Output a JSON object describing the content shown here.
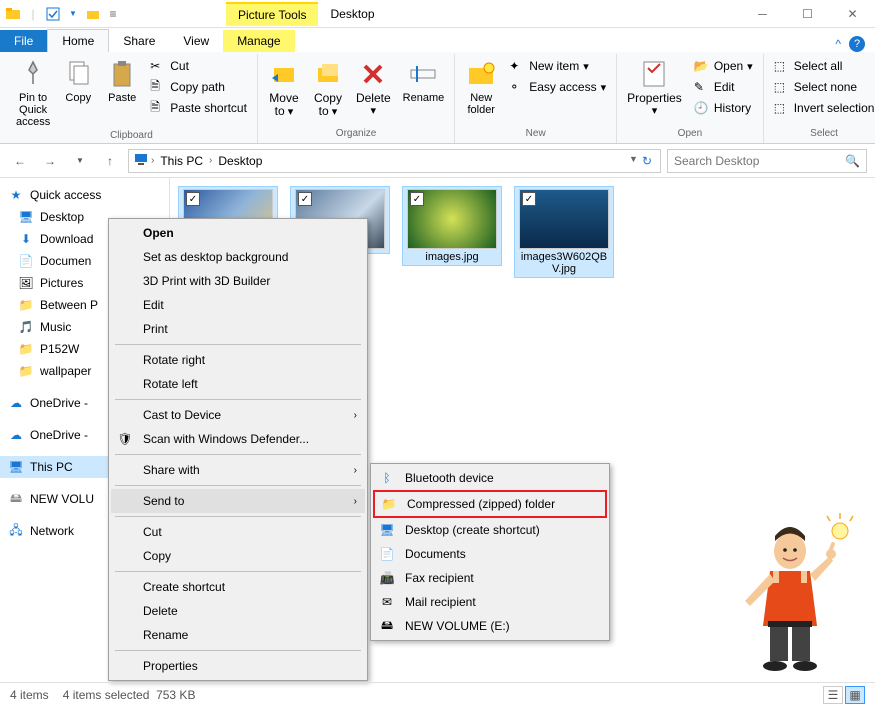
{
  "window": {
    "tool_tab_label": "Picture Tools",
    "title": "Desktop"
  },
  "tabs": {
    "file": "File",
    "home": "Home",
    "share": "Share",
    "view": "View",
    "manage": "Manage"
  },
  "ribbon": {
    "clipboard": {
      "label": "Clipboard",
      "pin": "Pin to Quick access",
      "copy": "Copy",
      "paste": "Paste",
      "cut": "Cut",
      "copy_path": "Copy path",
      "paste_shortcut": "Paste shortcut"
    },
    "organize": {
      "label": "Organize",
      "move_to": "Move to",
      "copy_to": "Copy to",
      "delete": "Delete",
      "rename": "Rename"
    },
    "new": {
      "label": "New",
      "new_folder": "New folder",
      "new_item": "New item",
      "easy_access": "Easy access"
    },
    "open": {
      "label": "Open",
      "properties": "Properties",
      "open": "Open",
      "edit": "Edit",
      "history": "History"
    },
    "select": {
      "label": "Select",
      "select_all": "Select all",
      "select_none": "Select none",
      "invert": "Invert selection"
    }
  },
  "breadcrumb": {
    "this_pc": "This PC",
    "desktop": "Desktop"
  },
  "search": {
    "placeholder": "Search Desktop"
  },
  "sidebar": {
    "quick_access": "Quick access",
    "items": [
      "Desktop",
      "Download",
      "Documen",
      "Pictures",
      "Between P",
      "Music",
      "P152W",
      "wallpaper"
    ],
    "onedrive1": "OneDrive -",
    "onedrive2": "OneDrive -",
    "this_pc": "This PC",
    "new_volume": "NEW VOLU",
    "network": "Network"
  },
  "files": [
    {
      "name": ""
    },
    {
      "name": ""
    },
    {
      "name": "images.jpg"
    },
    {
      "name": "images3W602QBV.jpg"
    }
  ],
  "context_menu": {
    "open": "Open",
    "set_bg": "Set as desktop background",
    "print3d": "3D Print with 3D Builder",
    "edit": "Edit",
    "print": "Print",
    "rotate_right": "Rotate right",
    "rotate_left": "Rotate left",
    "cast": "Cast to Device",
    "defender": "Scan with Windows Defender...",
    "share": "Share with",
    "send_to": "Send to",
    "cut": "Cut",
    "copy": "Copy",
    "shortcut": "Create shortcut",
    "delete": "Delete",
    "rename": "Rename",
    "properties": "Properties"
  },
  "send_to_menu": {
    "bluetooth": "Bluetooth device",
    "compressed": "Compressed (zipped) folder",
    "desktop": "Desktop (create shortcut)",
    "documents": "Documents",
    "fax": "Fax recipient",
    "mail": "Mail recipient",
    "volume": "NEW VOLUME (E:)"
  },
  "status": {
    "count": "4 items",
    "selected": "4 items selected",
    "size": "753 KB"
  }
}
